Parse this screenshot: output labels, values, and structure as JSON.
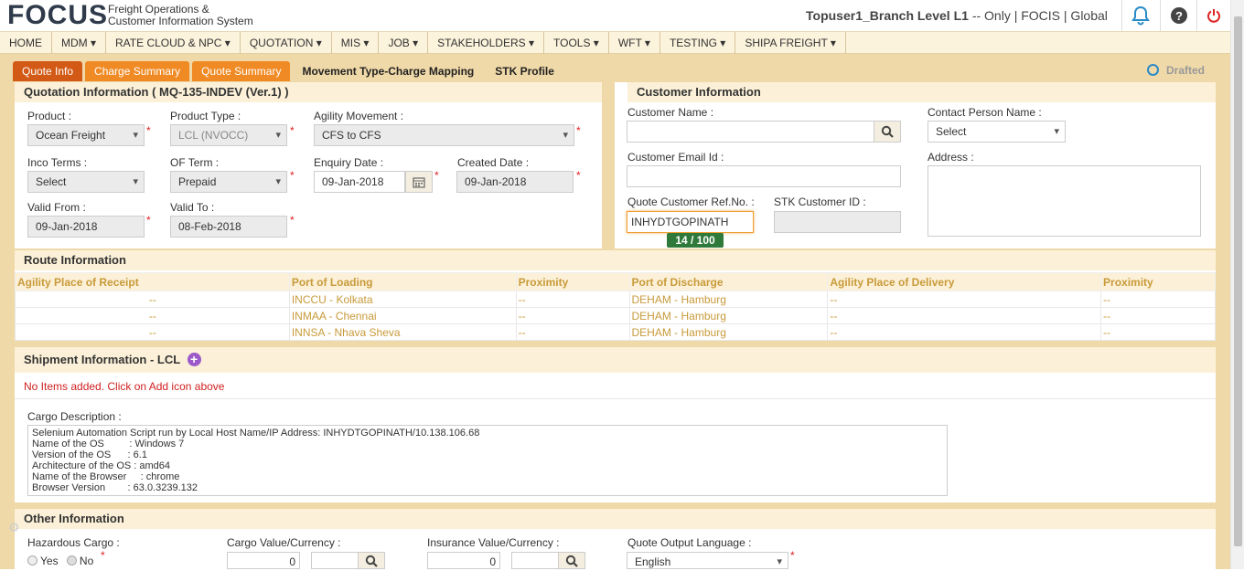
{
  "header": {
    "logo": "FOCUS",
    "tagline_1": "Freight Operations &",
    "tagline_2": "Customer Information System",
    "user": "Topuser1_Branch Level L1",
    "user_suffix": "-- Only",
    "context": "| FOCIS | Global"
  },
  "nav": [
    "HOME",
    "MDM ▾",
    "RATE CLOUD & NPC ▾",
    "QUOTATION ▾",
    "MIS ▾",
    "JOB ▾",
    "STAKEHOLDERS ▾",
    "TOOLS ▾",
    "WFT ▾",
    "TESTING ▾",
    "SHIPA FREIGHT ▾"
  ],
  "tabs": [
    "Quote Info",
    "Charge Summary",
    "Quote Summary",
    "Movement Type-Charge Mapping",
    "STK Profile"
  ],
  "status": "Drafted",
  "quotation": {
    "title": "Quotation Information ( MQ-135-INDEV  (Ver.1) )",
    "product_label": "Product :",
    "product_value": "Ocean Freight",
    "product_type_label": "Product Type :",
    "product_type_value": "LCL (NVOCC)",
    "agility_movement_label": "Agility Movement :",
    "agility_movement_value": "CFS to CFS",
    "inco_terms_label": "Inco Terms :",
    "inco_terms_value": "Select",
    "of_term_label": "OF Term :",
    "of_term_value": "Prepaid",
    "enquiry_date_label": "Enquiry Date :",
    "enquiry_date_value": "09-Jan-2018",
    "created_date_label": "Created Date :",
    "created_date_value": "09-Jan-2018",
    "valid_from_label": "Valid From :",
    "valid_from_value": "09-Jan-2018",
    "valid_to_label": "Valid To :",
    "valid_to_value": "08-Feb-2018"
  },
  "customer": {
    "title": "Customer Information",
    "name_label": "Customer Name :",
    "name_value": "",
    "contact_label": "Contact Person Name :",
    "contact_value": "Select",
    "email_label": "Customer Email Id :",
    "email_value": "",
    "address_label": "Address :",
    "ref_label": "Quote Customer Ref.No. :",
    "ref_value": "INHYDTGOPINATH",
    "ref_counter": "14 / 100",
    "stk_label": "STK Customer ID :",
    "stk_value": ""
  },
  "route": {
    "title": "Route Information",
    "columns": [
      "Agility Place of Receipt",
      "Port of Loading",
      "Proximity",
      "Port of Discharge",
      "Agility Place of Delivery",
      "Proximity"
    ],
    "rows": [
      [
        "--",
        "INCCU - Kolkata",
        "--",
        "DEHAM - Hamburg",
        "--",
        "--"
      ],
      [
        "--",
        "INMAA - Chennai",
        "--",
        "DEHAM - Hamburg",
        "--",
        "--"
      ],
      [
        "--",
        "INNSA - Nhava Sheva",
        "--",
        "DEHAM - Hamburg",
        "--",
        "--"
      ]
    ]
  },
  "shipment": {
    "title": "Shipment Information - LCL",
    "empty_msg": "No Items added. Click on Add icon above",
    "cargo_label": "Cargo Description :",
    "cargo_text": "Selenium Automation Script run by Local Host Name/IP Address: INHYDTGOPINATH/10.138.106.68\nName of the OS         : Windows 7\nVersion of the OS      : 6.1\nArchitecture of the OS : amd64\nName of the Browser     : chrome\nBrowser Version        : 63.0.3239.132"
  },
  "other": {
    "title": "Other Information",
    "hazardous_label": "Hazardous Cargo :",
    "yes": "Yes",
    "no": "No",
    "cargo_value_label": "Cargo Value/Currency :",
    "cargo_value": "0",
    "insurance_label": "Insurance Value/Currency :",
    "insurance_value": "0",
    "language_label": "Quote Output Language :",
    "language_value": "English"
  }
}
